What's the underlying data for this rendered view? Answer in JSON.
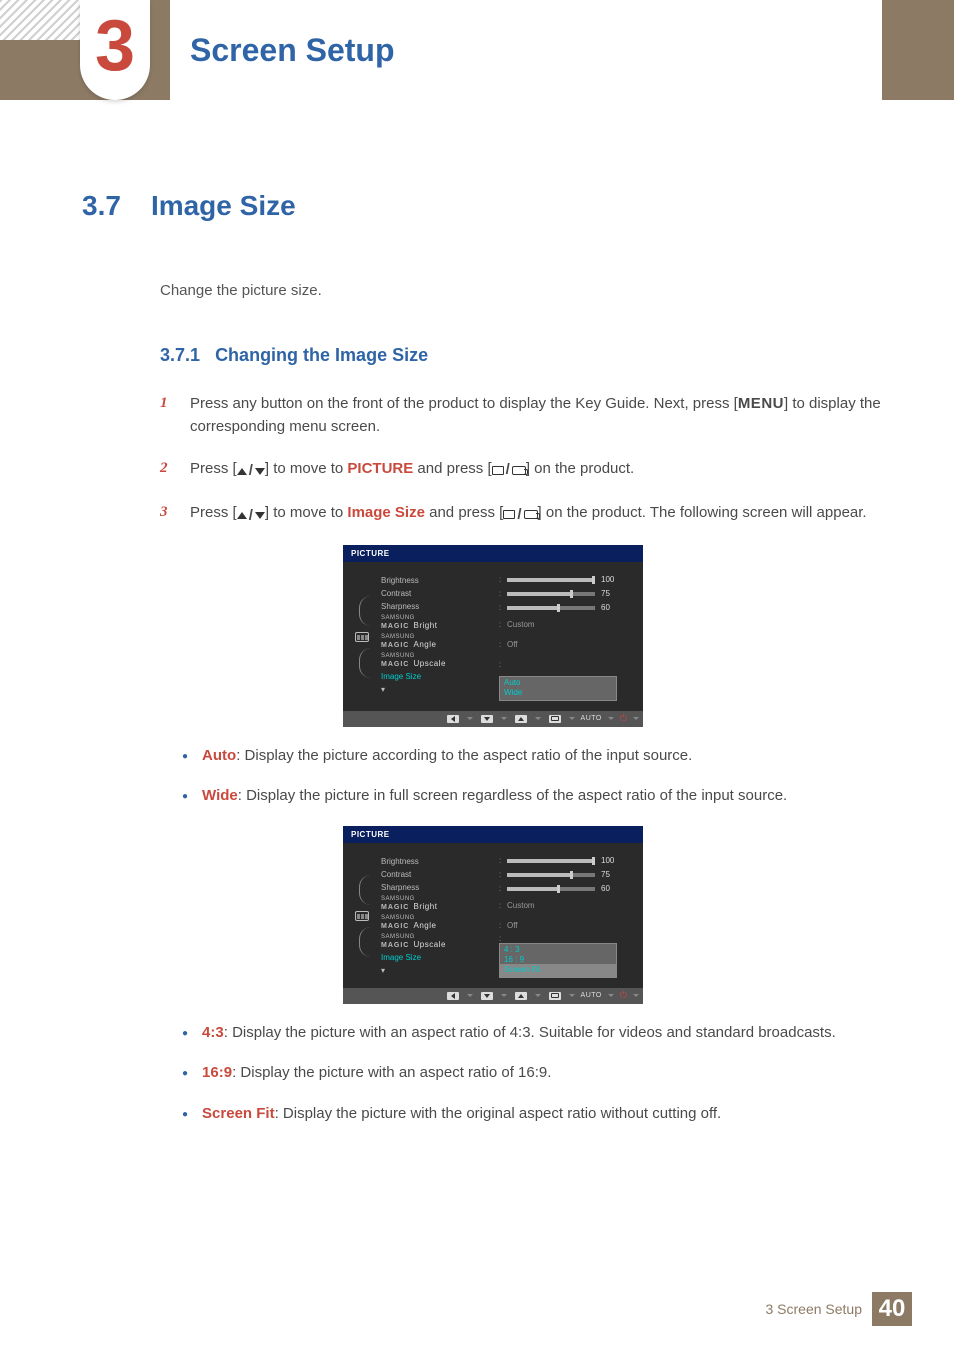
{
  "chapter": {
    "number": "3",
    "title": "Screen Setup"
  },
  "section": {
    "number": "3.7",
    "title": "Image Size",
    "intro": "Change the picture size."
  },
  "subsection": {
    "number": "3.7.1",
    "title": "Changing the Image Size"
  },
  "steps": {
    "s1": {
      "num": "1",
      "t1": "Press any button on the front of the product to display the Key Guide. Next, press [",
      "menu": "MENU",
      "t2": "] to display the corresponding menu screen."
    },
    "s2": {
      "num": "2",
      "t1": "Press [",
      "t2": "] to move to ",
      "picture": "PICTURE",
      "t3": " and press [",
      "t4": "] on the product."
    },
    "s3": {
      "num": "3",
      "t1": "Press [",
      "t2": "] to move to ",
      "imgsize": "Image Size",
      "t3": " and press [",
      "t4": "] on the product. The following screen will appear."
    }
  },
  "osd1": {
    "title": "PICTURE",
    "items": {
      "brightness": "Brightness",
      "contrast": "Contrast",
      "sharpness": "Sharpness",
      "magic_bright": "Bright",
      "magic_angle": "Angle",
      "magic_upscale": "Upscale",
      "image_size": "Image Size",
      "magic_prefix_top": "SAMSUNG",
      "magic_prefix": "MAGIC"
    },
    "values": {
      "brightness": "100",
      "contrast": "75",
      "sharpness": "60",
      "magic_bright": "Custom",
      "magic_angle": "Off"
    },
    "dropdown": [
      "Auto",
      "Wide"
    ],
    "footer_auto": "AUTO"
  },
  "bullets1": {
    "auto": {
      "label": "Auto",
      "text": ": Display the picture according to the aspect ratio of the input source."
    },
    "wide": {
      "label": "Wide",
      "text": ": Display the picture in full screen regardless of the aspect ratio of the input source."
    }
  },
  "osd2": {
    "title": "PICTURE",
    "dropdown": [
      "4 : 3",
      "16 : 9",
      "Screen Fit"
    ],
    "footer_auto": "AUTO"
  },
  "bullets2": {
    "b1": {
      "label": "4:3",
      "text": ": Display the picture with an aspect ratio of 4:3. Suitable for videos and standard broadcasts."
    },
    "b2": {
      "label": "16:9",
      "text": ": Display the picture with an aspect ratio of 16:9."
    },
    "b3": {
      "label": "Screen Fit",
      "text": ": Display the picture with the original aspect ratio without cutting off."
    }
  },
  "footer": {
    "chapter_label": "3 Screen Setup",
    "page": "40"
  }
}
